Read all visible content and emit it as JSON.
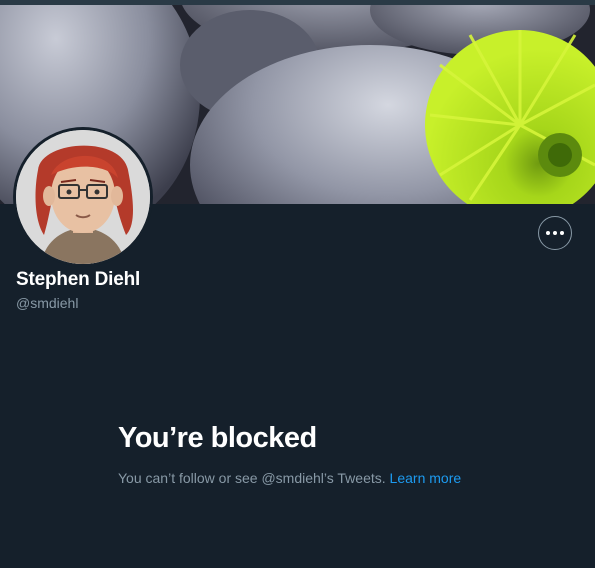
{
  "profile": {
    "display_name": "Stephen Diehl",
    "handle": "@smdiehl"
  },
  "actions": {
    "more_icon": "more-horizontal-icon"
  },
  "blocked": {
    "title": "You’re blocked",
    "message": "You can’t follow or see @smdiehl’s Tweets.",
    "link_label": "Learn more"
  },
  "colors": {
    "background": "#15202b",
    "primary_text": "#ffffff",
    "secondary_text": "#8899a6",
    "link": "#1d9bf0",
    "flower": "#b5e61d"
  }
}
